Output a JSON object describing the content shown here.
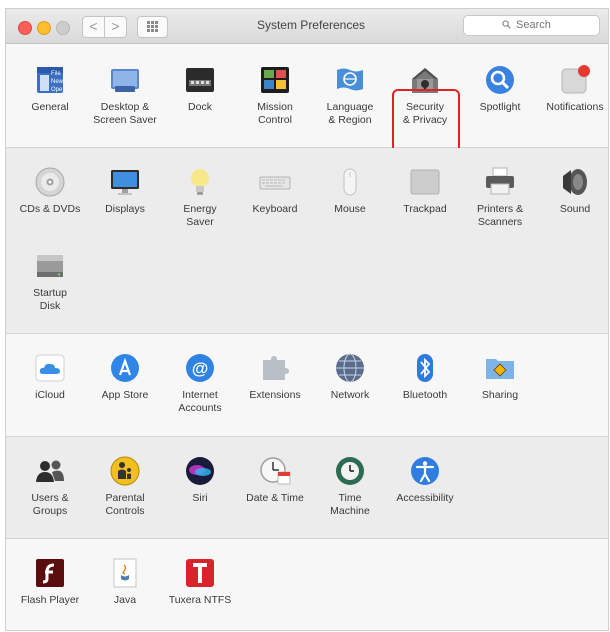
{
  "window": {
    "title": "System Preferences",
    "search_placeholder": "Search",
    "back_glyph": "<",
    "forward_glyph": ">"
  },
  "sections": [
    {
      "items": [
        {
          "label": "General",
          "icon": "general-icon"
        },
        {
          "label": "Desktop &\nScreen Saver",
          "icon": "desktop-icon"
        },
        {
          "label": "Dock",
          "icon": "dock-icon"
        },
        {
          "label": "Mission\nControl",
          "icon": "mission-control-icon"
        },
        {
          "label": "Language\n& Region",
          "icon": "flag-icon"
        },
        {
          "label": "Security\n& Privacy",
          "icon": "house-lock-icon",
          "highlighted": true
        },
        {
          "label": "Spotlight",
          "icon": "magnifier-icon"
        },
        {
          "label": "Notifications",
          "icon": "notifications-icon"
        }
      ]
    },
    {
      "items": [
        {
          "label": "CDs & DVDs",
          "icon": "disc-icon"
        },
        {
          "label": "Displays",
          "icon": "display-icon"
        },
        {
          "label": "Energy\nSaver",
          "icon": "bulb-icon"
        },
        {
          "label": "Keyboard",
          "icon": "keyboard-icon"
        },
        {
          "label": "Mouse",
          "icon": "mouse-icon"
        },
        {
          "label": "Trackpad",
          "icon": "trackpad-icon"
        },
        {
          "label": "Printers &\nScanners",
          "icon": "printer-icon"
        },
        {
          "label": "Sound",
          "icon": "speaker-icon"
        },
        {
          "label": "Startup\nDisk",
          "icon": "disk-icon"
        }
      ]
    },
    {
      "items": [
        {
          "label": "iCloud",
          "icon": "cloud-icon"
        },
        {
          "label": "App Store",
          "icon": "app-store-icon"
        },
        {
          "label": "Internet\nAccounts",
          "icon": "at-icon"
        },
        {
          "label": "Extensions",
          "icon": "puzzle-icon"
        },
        {
          "label": "Network",
          "icon": "globe-icon"
        },
        {
          "label": "Bluetooth",
          "icon": "bluetooth-icon"
        },
        {
          "label": "Sharing",
          "icon": "sharing-folder-icon"
        }
      ]
    },
    {
      "items": [
        {
          "label": "Users &\nGroups",
          "icon": "users-icon"
        },
        {
          "label": "Parental\nControls",
          "icon": "parental-icon"
        },
        {
          "label": "Siri",
          "icon": "siri-icon"
        },
        {
          "label": "Date & Time",
          "icon": "clock-calendar-icon"
        },
        {
          "label": "Time\nMachine",
          "icon": "time-machine-icon"
        },
        {
          "label": "Accessibility",
          "icon": "accessibility-icon"
        }
      ]
    },
    {
      "items": [
        {
          "label": "Flash Player",
          "icon": "flash-icon"
        },
        {
          "label": "Java",
          "icon": "java-icon"
        },
        {
          "label": "Tuxera NTFS",
          "icon": "tuxera-icon"
        }
      ]
    }
  ],
  "colors": {
    "highlight": "#e02424",
    "close": "#fc5f57",
    "minimize": "#fdbd2e"
  }
}
